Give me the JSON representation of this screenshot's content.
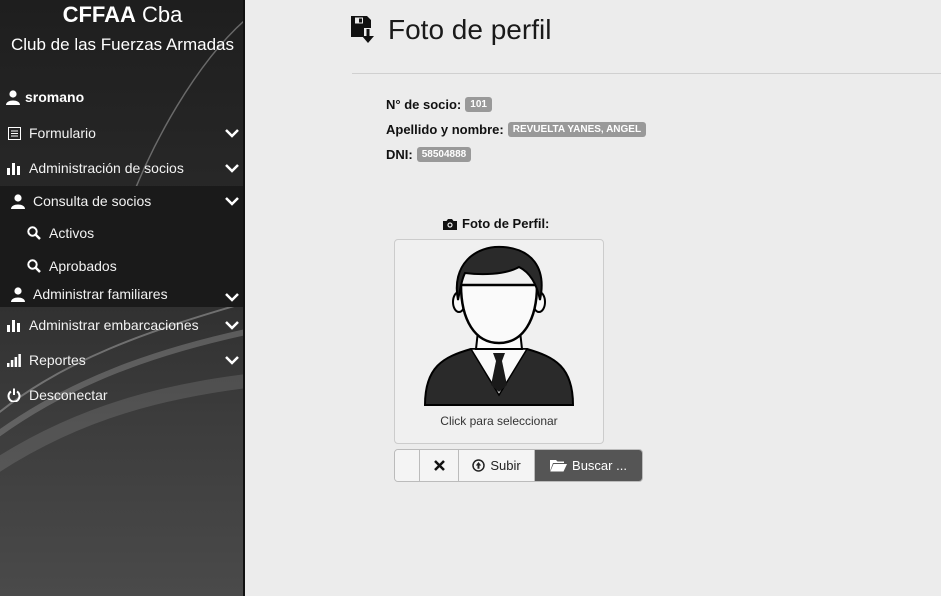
{
  "sidebar": {
    "brand_bold": "CFFAA",
    "brand_rest": " Cba",
    "subtitle": "Club de las Fuerzas Armadas",
    "username": "sromano",
    "items": [
      {
        "label": "Formulario",
        "icon": "list-icon"
      },
      {
        "label": "Administración de socios",
        "icon": "bar-chart-icon"
      },
      {
        "label": "Consulta de socios",
        "icon": "user-icon"
      },
      {
        "label": "Activos",
        "icon": "search-icon"
      },
      {
        "label": "Aprobados",
        "icon": "search-icon"
      },
      {
        "label": "Administrar familiares",
        "icon": "user-icon"
      },
      {
        "label": "Administrar embarcaciones",
        "icon": "bar-chart-icon"
      },
      {
        "label": "Reportes",
        "icon": "signal-icon"
      },
      {
        "label": "Desconectar",
        "icon": "power-icon"
      }
    ]
  },
  "main": {
    "title": "Foto de perfil",
    "socio_label": "N° de socio:",
    "socio_value": "101",
    "nombre_label": "Apellido y nombre:",
    "nombre_value": "REVUELTA YANES, ANGEL",
    "dni_label": "DNI:",
    "dni_value": "58504888",
    "foto_label": "Foto de Perfil:",
    "click_label": "Click para seleccionar",
    "subir_label": "Subir",
    "buscar_label": "Buscar ..."
  }
}
